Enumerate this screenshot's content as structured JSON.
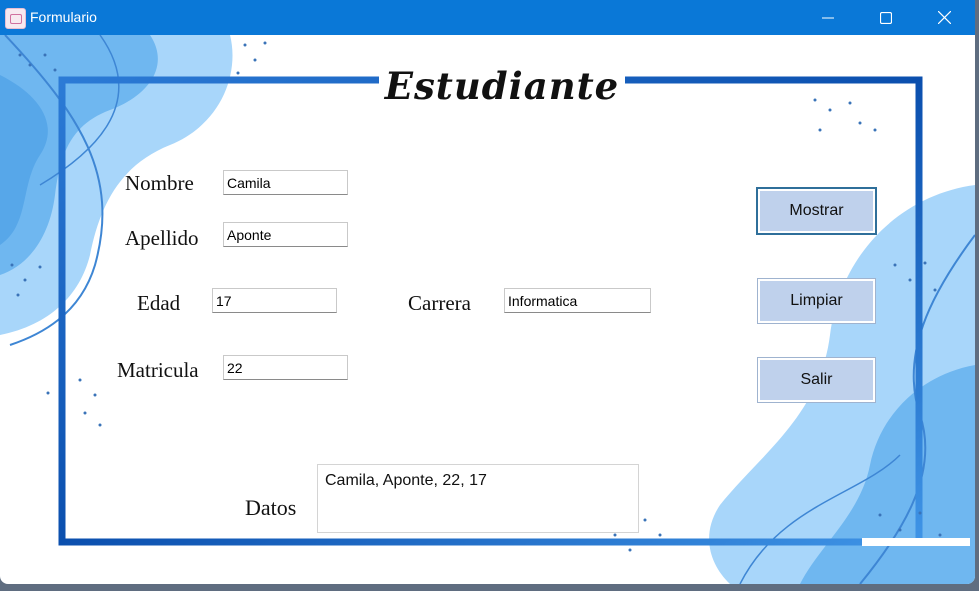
{
  "window": {
    "title": "Formulario"
  },
  "form": {
    "heading": "Estudiante",
    "nombre": {
      "label": "Nombre",
      "value": "Camila"
    },
    "apellido": {
      "label": "Apellido",
      "value": "Aponte"
    },
    "edad": {
      "label": "Edad",
      "value": "17"
    },
    "carrera": {
      "label": "Carrera",
      "value": "Informatica"
    },
    "matricula": {
      "label": "Matricula",
      "value": "22"
    },
    "datos": {
      "label": "Datos",
      "value": "Camila, Aponte, 22, 17"
    }
  },
  "buttons": {
    "mostrar": "Mostrar",
    "limpiar": "Limpiar",
    "salir": "Salir"
  },
  "colors": {
    "titlebar": "#0a78d7",
    "frame": "#1565c0",
    "button": "#bfd1ec",
    "blob_light": "#9fd0f7",
    "blob_mid": "#5aa6e8"
  }
}
